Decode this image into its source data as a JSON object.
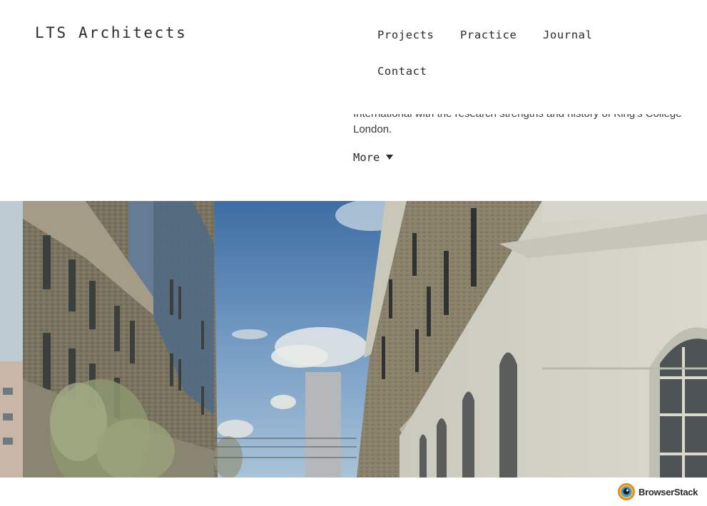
{
  "site": {
    "logo": "LTS Architects"
  },
  "nav": {
    "items": [
      {
        "label": "Projects"
      },
      {
        "label": "Practice"
      },
      {
        "label": "Journal"
      },
      {
        "label": "Contact"
      }
    ]
  },
  "intro": {
    "text": "International with the research strengths and history of King's College London.",
    "more_label": "More",
    "more_icon": "caret-down-icon"
  },
  "hero": {
    "image": "architectural-rendering-street-view"
  },
  "badge": {
    "label": "BrowserStack",
    "icon": "browserstack-logo-icon"
  }
}
